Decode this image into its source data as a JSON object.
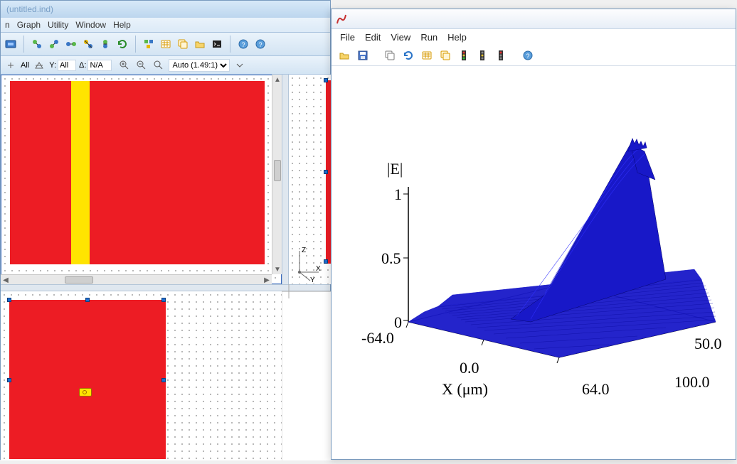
{
  "left": {
    "title": "(untitled.ind)",
    "menus": [
      "n",
      "Graph",
      "Utility",
      "Window",
      "Help"
    ],
    "viewctrl": {
      "all_label": "All",
      "y_label": "Y:",
      "y_value": "All",
      "delta_label": "Δ:",
      "delta_value": "N/A",
      "zoom_options": [
        "Auto (1.49:1)"
      ],
      "zoom_selected": "Auto (1.49:1)"
    },
    "axis_gizmo": {
      "z": "Z",
      "x": "X",
      "y": "Y"
    }
  },
  "right": {
    "menus": [
      "File",
      "Edit",
      "View",
      "Run",
      "Help"
    ],
    "plot": {
      "zlabel": "|E|",
      "xlabel": "X (μm)",
      "zticks": [
        "0",
        "0.5",
        "1"
      ],
      "xticks": [
        "-64.0",
        "0.0",
        "64.0"
      ],
      "yticks": [
        "50.0",
        "100.0"
      ]
    }
  },
  "chart_data": {
    "type": "area",
    "title": "|E|",
    "xlabel": "X (μm)",
    "ylabel": "",
    "zlabel": "|E|",
    "x_range": [
      -64.0,
      64.0
    ],
    "y_range": [
      0,
      100.0
    ],
    "z_range": [
      0,
      1
    ],
    "note": "3D surface plot of |E| field magnitude over X and propagation distance; a narrow high-amplitude ridge near X≈0 grows from ~0 at y=0 to ~1 at y=100; broad low-amplitude ripple elsewhere."
  },
  "colors": {
    "red": "#ed1c24",
    "yellow": "#ffe400",
    "plot_blue": "#1818c8"
  }
}
